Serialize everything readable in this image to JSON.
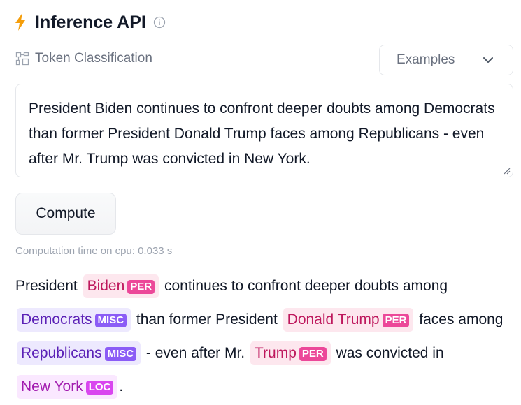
{
  "header": {
    "title": "Inference API",
    "icon": "lightning-bolt-icon",
    "info_icon": "info-icon"
  },
  "task": {
    "label": "Token Classification",
    "icon": "token-classification-icon"
  },
  "examples": {
    "label": "Examples",
    "icon": "chevron-down-icon"
  },
  "input": {
    "value": "President Biden continues to confront deeper doubts among Democrats than former President Donald Trump faces among Republicans - even after Mr. Trump was convicted in New York."
  },
  "compute_button": {
    "label": "Compute"
  },
  "computation_time": "Computation time on cpu: 0.033 s",
  "colors": {
    "per": "#ec4899",
    "misc": "#8b5cf6",
    "loc": "#d946ef",
    "accent": "#f59e0b"
  },
  "output": {
    "t0": "President",
    "e0": {
      "text": "Biden",
      "label": "PER"
    },
    "t1": "continues to confront deeper doubts among",
    "e1": {
      "text": "Democrats",
      "label": "MISC"
    },
    "t2": "than former President",
    "e2": {
      "text": "Donald Trump",
      "label": "PER"
    },
    "t3": "faces among",
    "e3": {
      "text": "Republicans",
      "label": "MISC"
    },
    "t4": "- even after Mr.",
    "e4": {
      "text": "Trump",
      "label": "PER"
    },
    "t5": "was convicted in",
    "e5": {
      "text": "New York",
      "label": "LOC"
    },
    "t6": "."
  }
}
